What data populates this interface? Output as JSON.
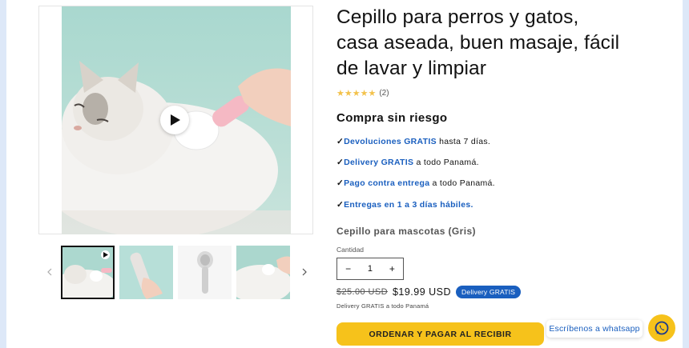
{
  "product": {
    "title": "Cepillo para perros y gatos, casa aseada, buen masaje, fácil de lavar y limpiar",
    "stars": "★★★★★",
    "review_count": "(2)"
  },
  "benefits": {
    "heading": "Compra sin riesgo",
    "check": "✓",
    "items": [
      {
        "highlight": "Devoluciones GRATIS",
        "rest": " hasta 7 días."
      },
      {
        "highlight": "Delivery GRATIS",
        "rest": " a todo Panamá."
      },
      {
        "highlight": "Pago contra entrega",
        "rest": " a todo Panamá."
      },
      {
        "highlight": "Entregas en 1 a 3 días hábiles.",
        "rest": ""
      }
    ]
  },
  "variant": {
    "label": "Cepillo para mascotas (Gris)"
  },
  "quantity": {
    "label": "Cantidad",
    "minus": "−",
    "value": "1",
    "plus": "+"
  },
  "price": {
    "old": "$25.00 USD",
    "current": "$19.99 USD",
    "badge": "Delivery GRATIS",
    "note": "Delivery GRATIS a todo Panamá"
  },
  "cta": {
    "label": "ORDENAR Y PAGAR AL RECIBIR"
  },
  "whatsapp": {
    "bubble": "Escríbenos a whatsapp"
  },
  "gallery": {
    "thumb_count": 4,
    "active_index": 0
  },
  "colors": {
    "accent_yellow": "#f6c21b",
    "link_blue": "#1a5fbf",
    "photo_bg": "#a9d8cf",
    "star": "#f3c24b"
  }
}
